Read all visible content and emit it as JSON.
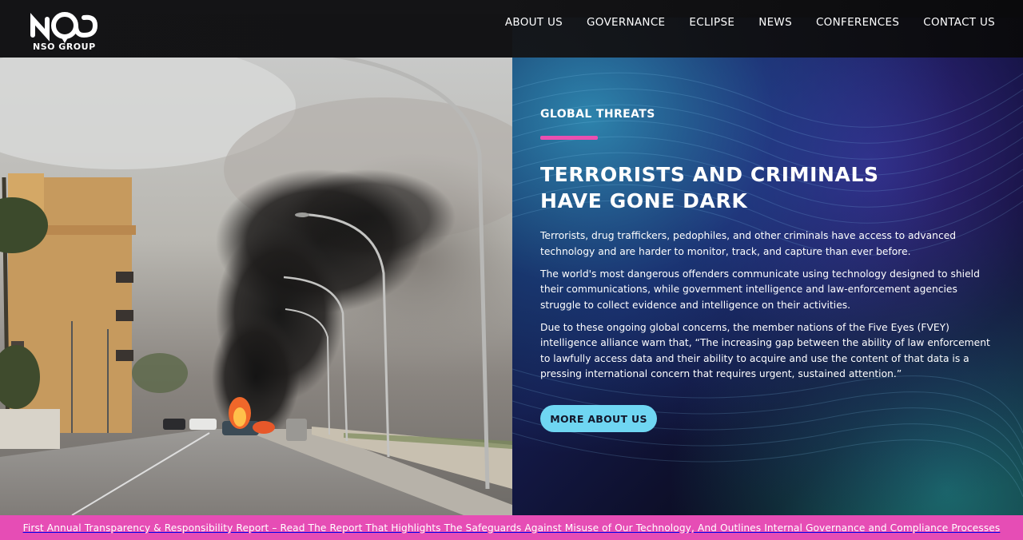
{
  "brand": {
    "logo_text": "NSO GROUP",
    "logo_icon": "nso-logo-icon",
    "accent_pink": "#e64db5",
    "accent_cyan": "#6fd6f2"
  },
  "nav": {
    "items": [
      {
        "label": "ABOUT US"
      },
      {
        "label": "GOVERNANCE"
      },
      {
        "label": "ECLIPSE"
      },
      {
        "label": "NEWS"
      },
      {
        "label": "CONFERENCES"
      },
      {
        "label": "CONTACT US"
      }
    ]
  },
  "hero": {
    "eyebrow": "GLOBAL THREATS",
    "headline_line1": "TERRORISTS AND CRIMINALS",
    "headline_line2": "HAVE GONE DARK",
    "paragraphs": [
      "Terrorists, drug traffickers, pedophiles, and other criminals have access to advanced technology and are harder to monitor, track, and capture than ever before.",
      "The world's most dangerous offenders communicate using technology designed to shield their communications, while government intelligence and law-enforcement agencies struggle to collect evidence and intelligence on their activities.",
      "Due to these ongoing global concerns, the member nations of the Five Eyes (FVEY) intelligence alliance warn that, “The increasing gap between the ability of law enforcement to lawfully access data and their ability to acquire and use the content of that data is a pressing international concern that requires urgent, sustained attention.”"
    ],
    "cta_label": "MORE ABOUT US"
  },
  "banner": {
    "text": "First Annual Transparency & Responsibility Report – Read The Report That Highlights The Safeguards Against Misuse of Our Technology, And Outlines Internal Governance and Compliance Processes"
  }
}
